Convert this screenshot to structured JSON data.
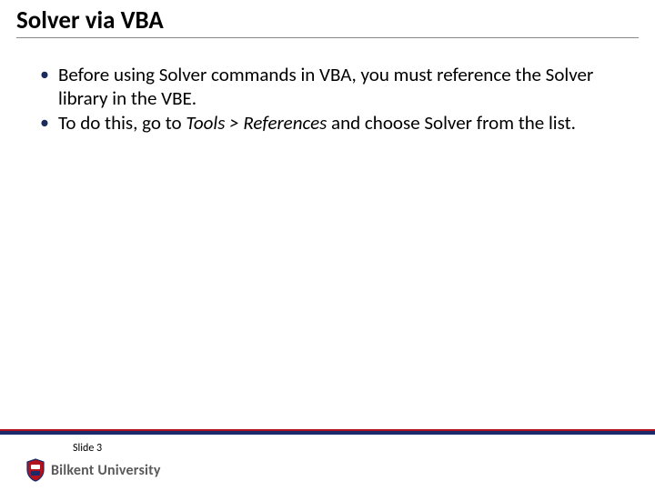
{
  "title": "Solver via VBA",
  "bullets": [
    {
      "pre": "Before using Solver commands in VBA, you must reference the Solver library in the VBE.",
      "ital": "",
      "post": ""
    },
    {
      "pre": "To do this, go to ",
      "ital": "Tools > References",
      "post": " and choose Solver from the list."
    }
  ],
  "footer": {
    "slide_label": "Slide 3",
    "university": "Bilkent University"
  }
}
